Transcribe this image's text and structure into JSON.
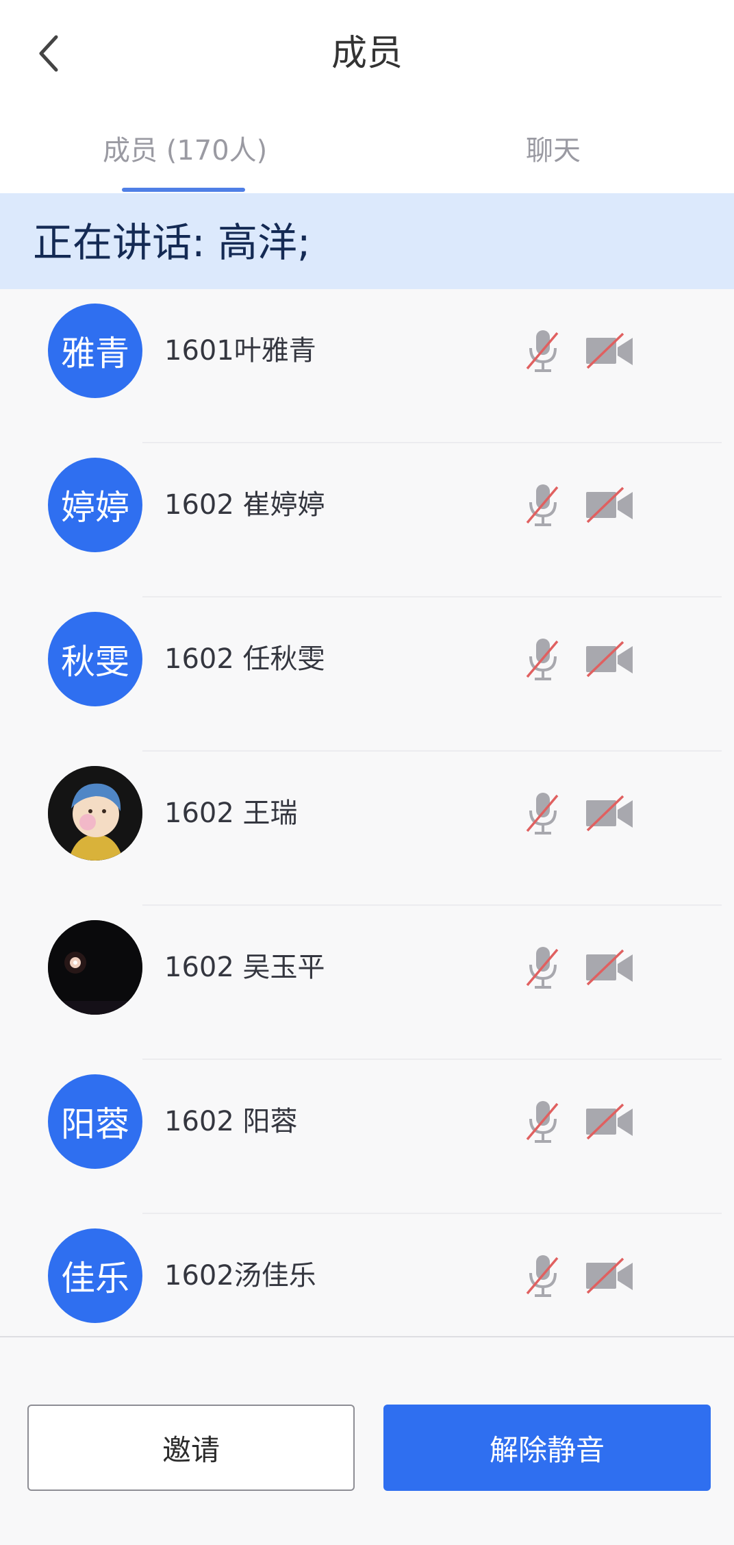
{
  "header": {
    "title": "成员",
    "back_icon": "chevron-left-icon"
  },
  "tabs": [
    {
      "label": "成员 (170人)",
      "active": true
    },
    {
      "label": "聊天",
      "active": false
    }
  ],
  "speaking": {
    "text": "正在讲话: 高洋;"
  },
  "members": [
    {
      "avatar_text": "雅青",
      "avatar_type": "initials",
      "name": "1601叶雅青",
      "mic": "muted",
      "camera": "off"
    },
    {
      "avatar_text": "婷婷",
      "avatar_type": "initials",
      "name": "1602 崔婷婷",
      "mic": "muted",
      "camera": "off"
    },
    {
      "avatar_text": "秋雯",
      "avatar_type": "initials",
      "name": "1602 任秋雯",
      "mic": "muted",
      "camera": "off"
    },
    {
      "avatar_text": "",
      "avatar_type": "photo-girl-pearl-earring",
      "name": "1602 王瑞",
      "mic": "muted",
      "camera": "off"
    },
    {
      "avatar_text": "",
      "avatar_type": "photo-fireworks",
      "name": "1602 吴玉平",
      "mic": "muted",
      "camera": "off"
    },
    {
      "avatar_text": "阳蓉",
      "avatar_type": "initials",
      "name": "1602 阳蓉",
      "mic": "muted",
      "camera": "off"
    },
    {
      "avatar_text": "佳乐",
      "avatar_type": "initials",
      "name": "1602汤佳乐",
      "mic": "muted",
      "camera": "off"
    }
  ],
  "footer": {
    "invite_label": "邀请",
    "unmute_label": "解除静音"
  },
  "colors": {
    "accent": "#2f6ff0",
    "banner": "#dce9fc",
    "mute_slash": "#e06060",
    "icon_gray": "#a8a8ae"
  }
}
